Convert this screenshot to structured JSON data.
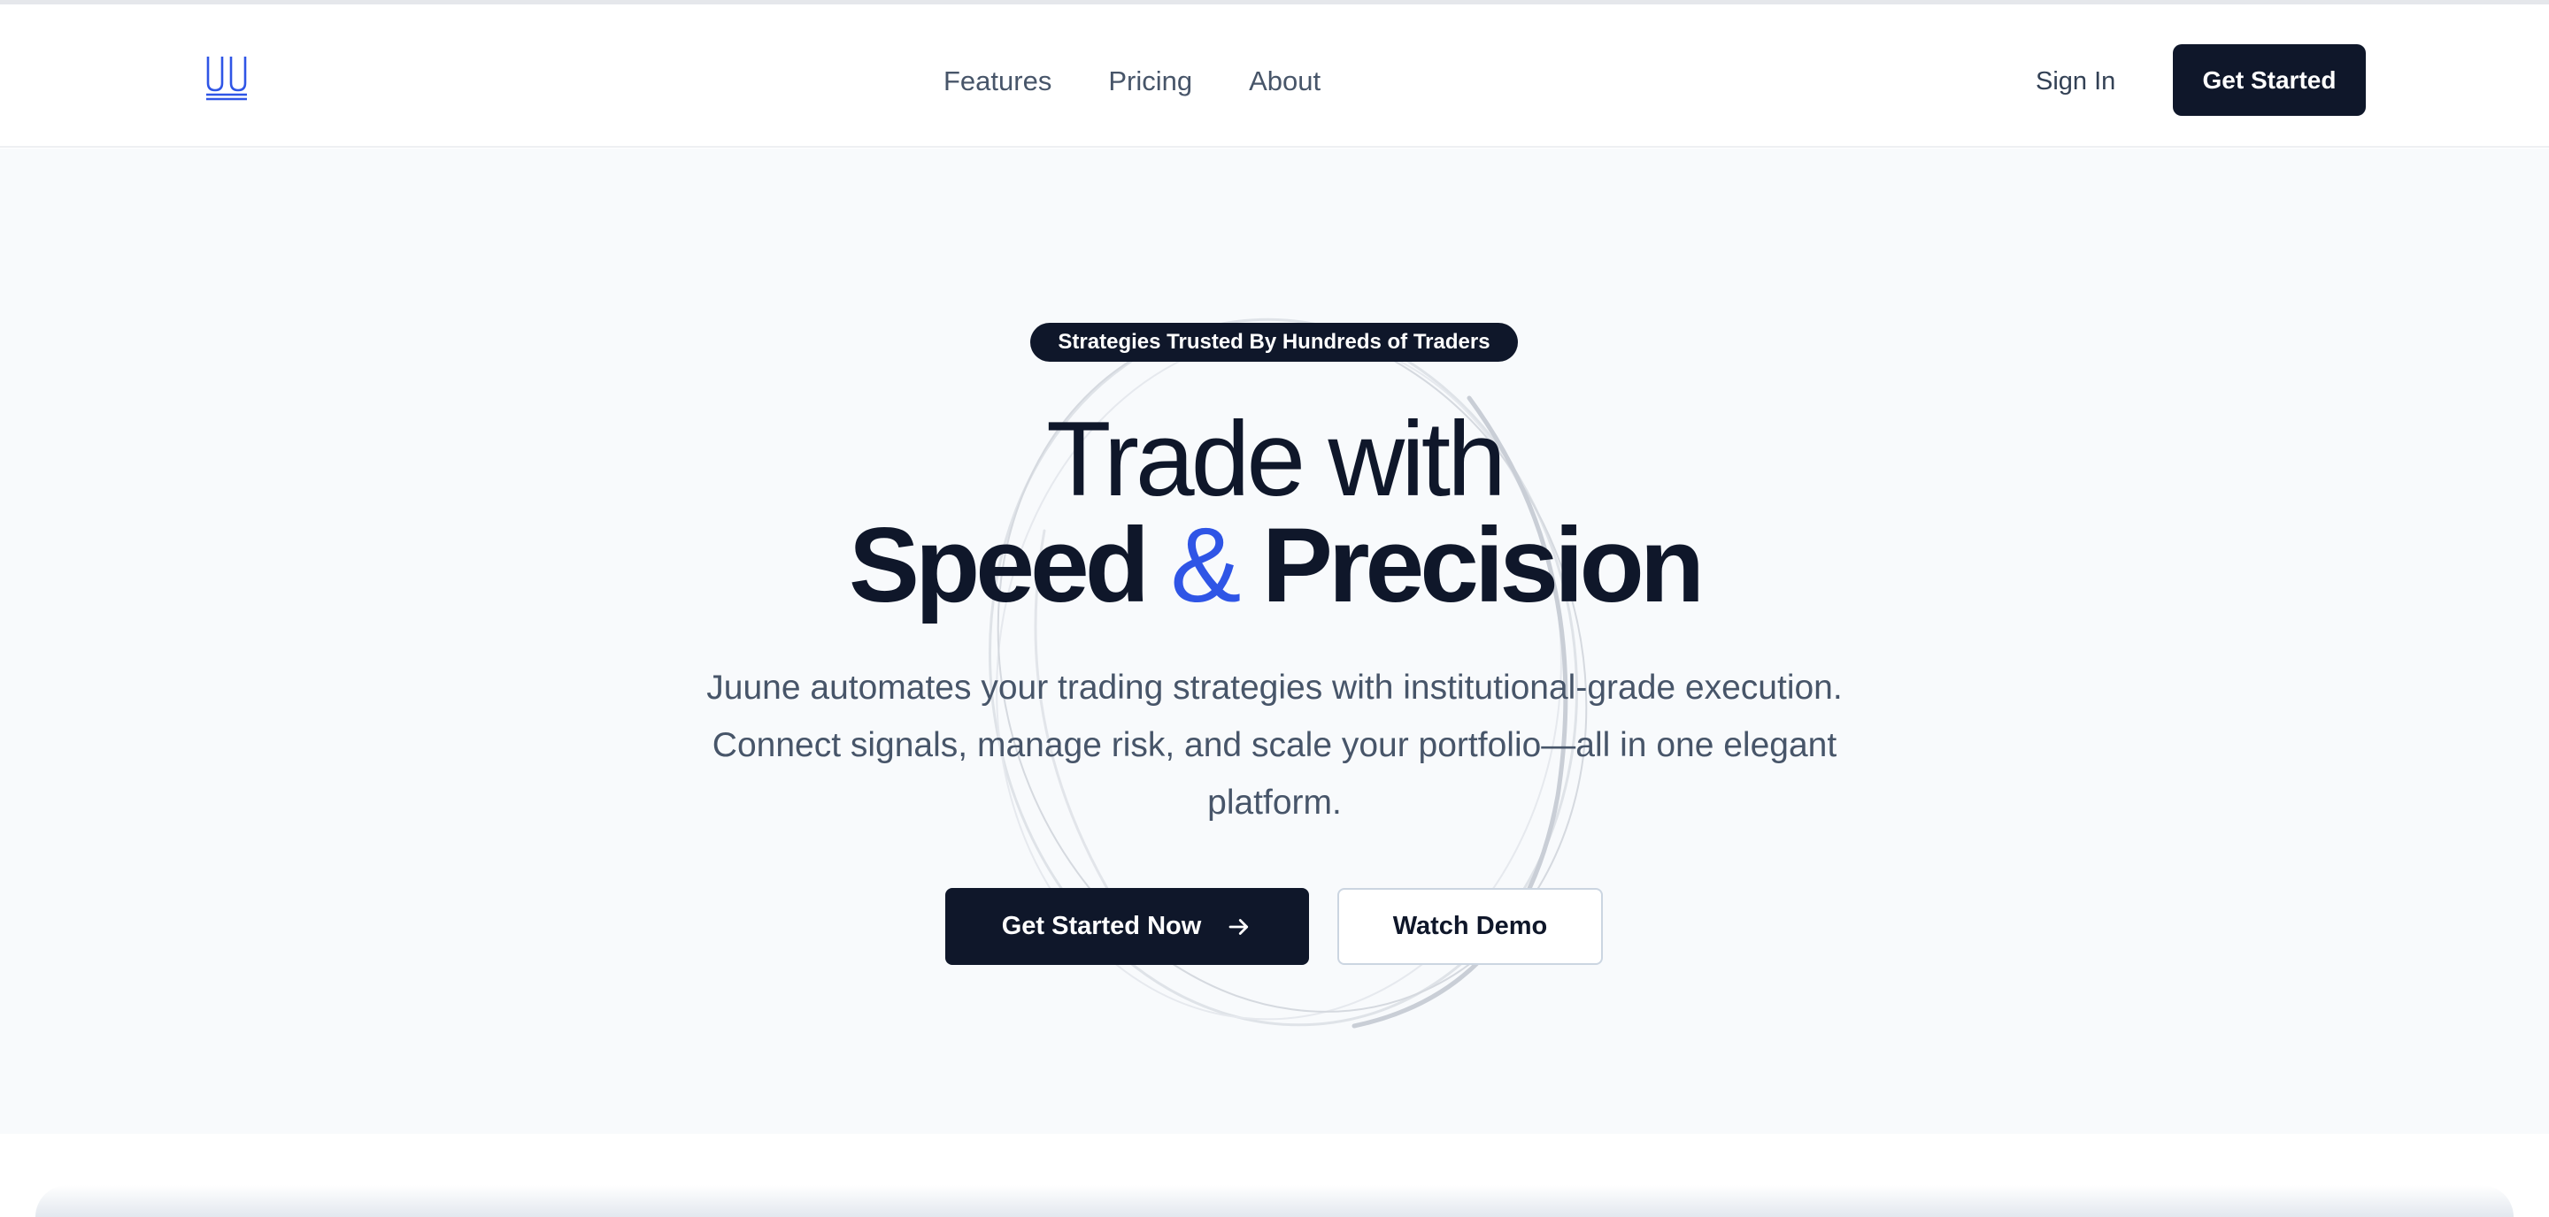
{
  "header": {
    "logo_icon": "juune-logo-icon",
    "nav": [
      "Features",
      "Pricing",
      "About"
    ],
    "sign_in": "Sign In",
    "cta": "Get Started"
  },
  "hero": {
    "badge": "Strategies Trusted By Hundreds of Traders",
    "headline_line1": "Trade with",
    "headline_word1": "Speed",
    "headline_amp": "&",
    "headline_word2": "Precision",
    "subtitle": "Juune automates your trading strategies with institutional-grade execution. Connect signals, manage risk, and scale your portfolio—all in one elegant platform.",
    "primary_cta": "Get Started Now",
    "primary_cta_icon": "arrow-right-icon",
    "secondary_cta": "Watch Demo"
  },
  "colors": {
    "accent": "#2f55e6",
    "dark": "#0f172a",
    "hero_bg": "#f8fafc",
    "muted_text": "#475569"
  }
}
